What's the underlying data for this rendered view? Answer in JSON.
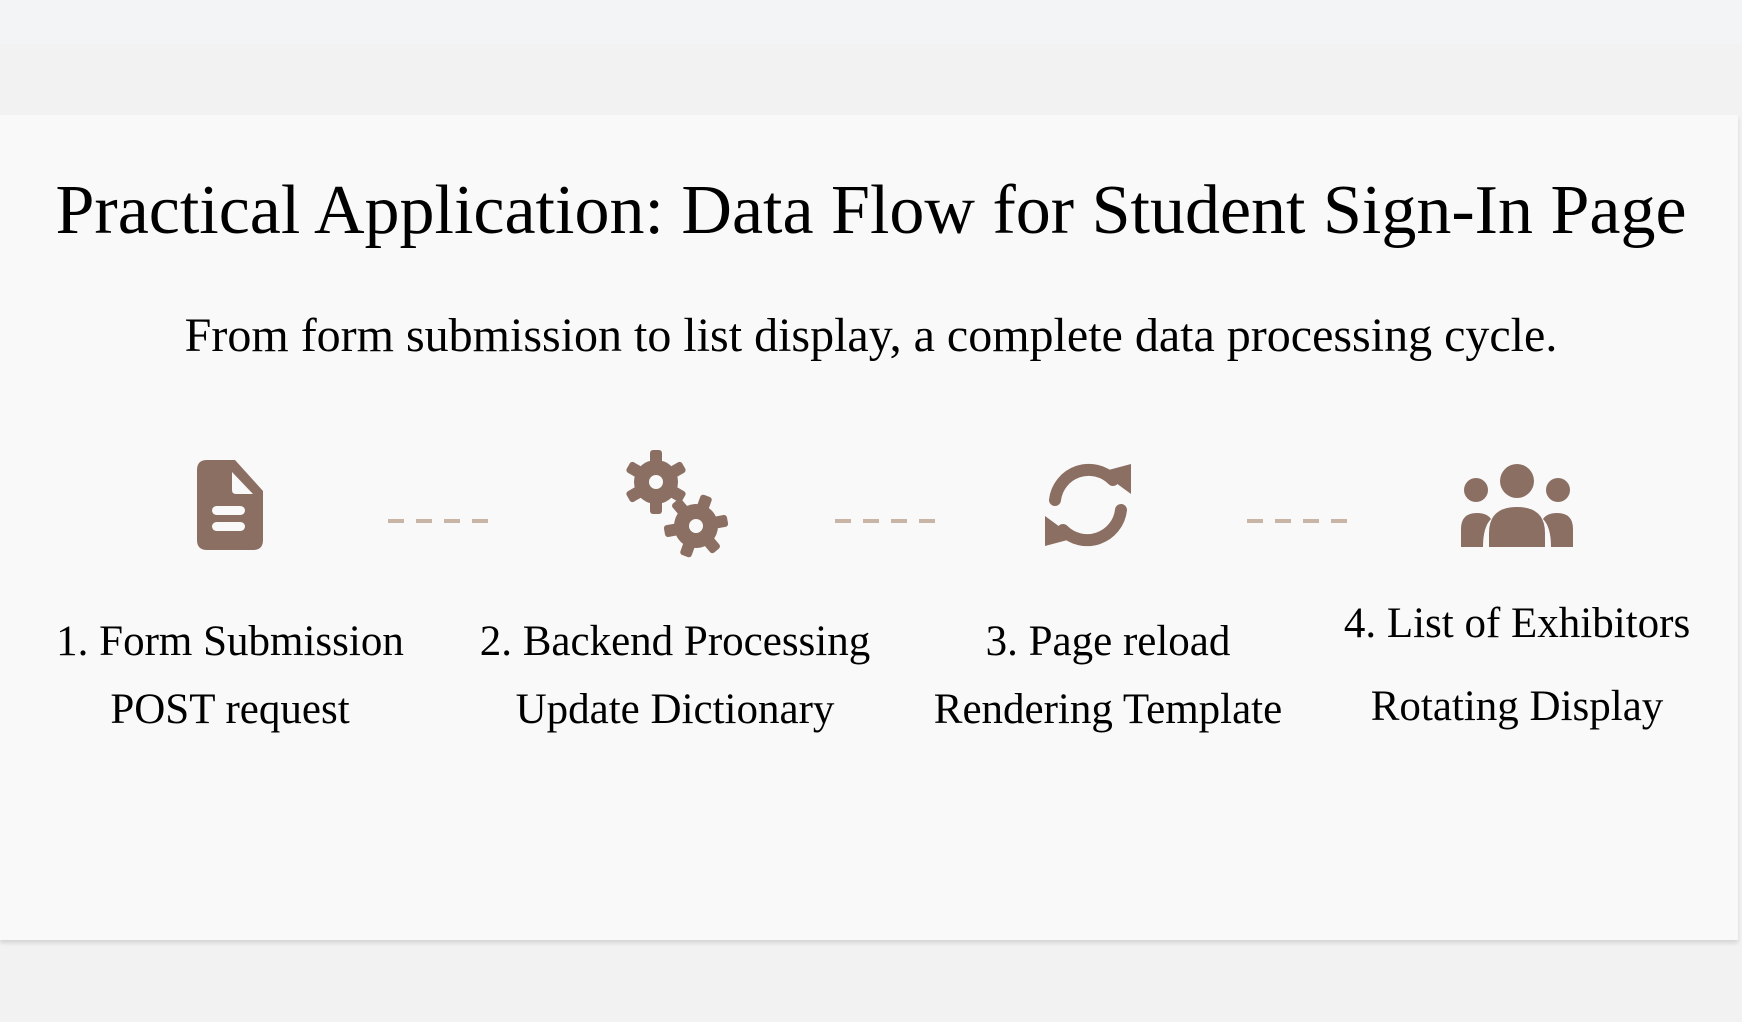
{
  "title": "Practical Application: Data Flow for Student Sign-In Page",
  "subtitle": "From form submission to list display, a complete data processing cycle.",
  "colors": {
    "icon": "#8c6f63",
    "connector": "#c8b5a6"
  },
  "steps": [
    {
      "icon": "file-icon",
      "label": "1. Form Submission",
      "detail": "POST request"
    },
    {
      "icon": "gears-icon",
      "label": "2. Backend Processing",
      "detail": "Update Dictionary"
    },
    {
      "icon": "sync-icon",
      "label": "3. Page reload",
      "detail": "Rendering Template"
    },
    {
      "icon": "users-icon",
      "label": "4. List of Exhibitors",
      "detail": "Rotating Display"
    }
  ]
}
